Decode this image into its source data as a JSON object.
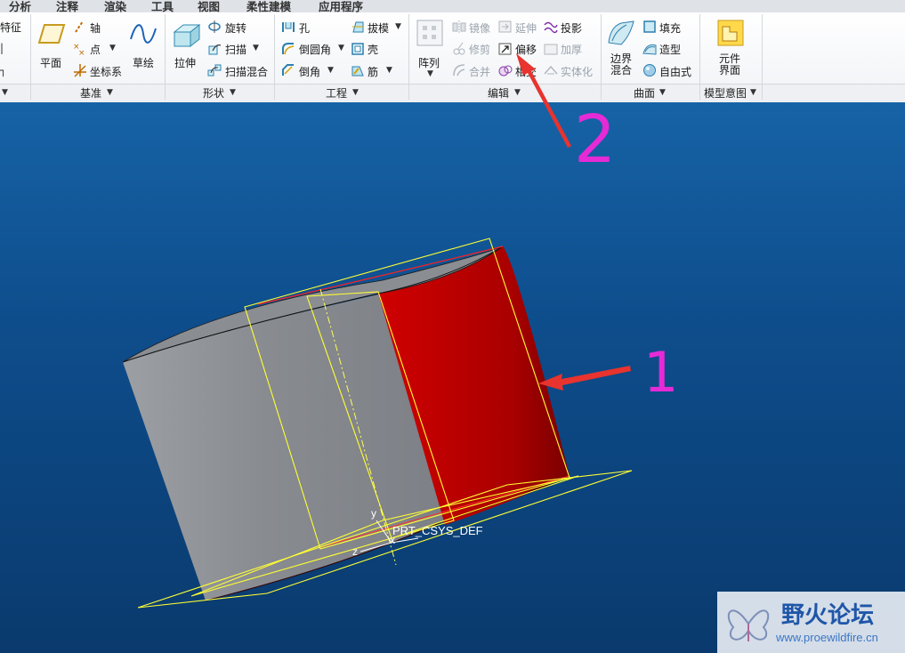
{
  "tabs": [
    "分析",
    "注释",
    "渲染",
    "工具",
    "视图",
    "柔性建模",
    "应用程序"
  ],
  "datum": {
    "partial_feature": "特征",
    "plane": "平面",
    "axis": "轴",
    "point": "点",
    "csys": "坐标系",
    "sketch": "草绘",
    "group": "基准"
  },
  "shapes": {
    "extrude": "拉伸",
    "revolve": "旋转",
    "sweep": "扫描",
    "swept_blend": "扫描混合",
    "group": "形状"
  },
  "engineering": {
    "hole": "孔",
    "round": "倒圆角",
    "chamfer": "倒角",
    "draft": "拔模",
    "shell": "壳",
    "rib": "筋",
    "group": "工程"
  },
  "editing": {
    "pattern": "阵列",
    "mirror": "镜像",
    "trim": "修剪",
    "merge": "合并",
    "extend": "延伸",
    "offset": "偏移",
    "intersect": "相交",
    "project": "投影",
    "thicken": "加厚",
    "solidify": "实体化",
    "group": "编辑"
  },
  "surfaces": {
    "boundary_blend_line1": "边界",
    "boundary_blend_line2": "混合",
    "fill": "填充",
    "style": "造型",
    "freestyle": "自由式",
    "group": "曲面"
  },
  "model_intent": {
    "component_interface_line1": "元件",
    "component_interface_line2": "界面",
    "group": "模型意图"
  },
  "viewport": {
    "csys_label": "PRT_CSYS_DEF",
    "axis_x": "x",
    "axis_y": "y",
    "axis_z": "z",
    "annotation_1": "1",
    "annotation_2": "2"
  },
  "watermark": {
    "name": "野火论坛",
    "url": "www.proewildfire.cn"
  },
  "colors": {
    "highlight_surface": "#c00000",
    "annotation": "#e62ad6",
    "arrow": "#e8332e",
    "datum_plane": "#ffff33",
    "background_top": "#1663a6",
    "background_bottom": "#0a3a6d"
  }
}
